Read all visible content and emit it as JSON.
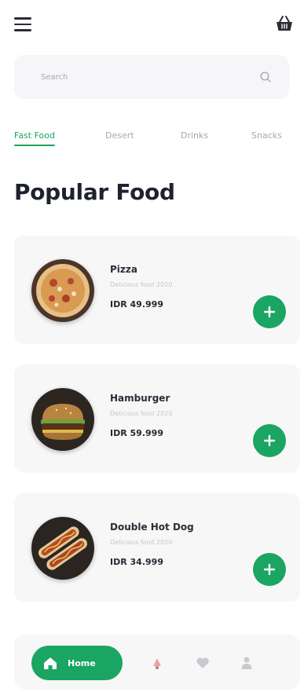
{
  "search": {
    "placeholder": "Search"
  },
  "categories": [
    {
      "label": "Fast Food",
      "active": true
    },
    {
      "label": "Desert",
      "active": false
    },
    {
      "label": "Drinks",
      "active": false
    },
    {
      "label": "Snacks",
      "active": false
    }
  ],
  "section": {
    "title": "Popular Food"
  },
  "foods": [
    {
      "name": "Pizza",
      "description": "Delicious food 2020",
      "price": "IDR 49.999"
    },
    {
      "name": "Hamburger",
      "description": "Delicious food 2020",
      "price": "IDR 59.999"
    },
    {
      "name": "Double Hot Dog",
      "description": "Delicious food 2020",
      "price": "IDR 34.999"
    }
  ],
  "nav": {
    "home_label": "Home"
  },
  "colors": {
    "accent": "#1aa562",
    "card_bg": "#f7f7f8",
    "search_bg": "#f6f6f8",
    "text_dark": "#1e2230",
    "text_muted": "#a6a8ad"
  },
  "icons": {
    "menu": "hamburger-menu-icon",
    "cart": "basket-icon",
    "search": "magnifier-icon",
    "add": "plus-icon",
    "home": "house-icon",
    "nav": [
      "notification-icon",
      "heart-icon",
      "user-icon"
    ]
  }
}
